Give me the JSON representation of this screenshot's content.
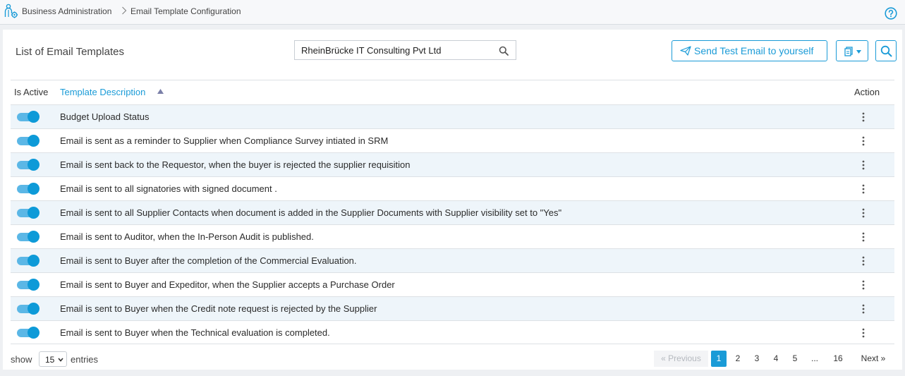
{
  "breadcrumb": {
    "items": [
      "Business Administration",
      "Email Template Configuration"
    ]
  },
  "page": {
    "title": "List of Email Templates"
  },
  "company_filter": {
    "value": "RheinBrücke IT Consulting Pvt Ltd"
  },
  "toolbar": {
    "send_test_label": "Send Test Email to yourself"
  },
  "table": {
    "columns": {
      "is_active": "Is Active",
      "description": "Template Description",
      "action": "Action"
    },
    "sort": {
      "column": "Template Description",
      "direction": "ascending"
    },
    "rows": [
      {
        "active": true,
        "description": "Budget Upload Status"
      },
      {
        "active": true,
        "description": "Email is sent as a reminder to Supplier when Compliance Survey intiated in SRM"
      },
      {
        "active": true,
        "description": "Email is sent back to the Requestor, when the buyer is rejected the supplier requisition"
      },
      {
        "active": true,
        "description": "Email is sent to all signatories with signed document ."
      },
      {
        "active": true,
        "description": "Email is sent to all Supplier Contacts when document is added in the Supplier Documents with Supplier visibility set to \"Yes\""
      },
      {
        "active": true,
        "description": "Email is sent to Auditor, when the In-Person Audit is published."
      },
      {
        "active": true,
        "description": "Email is sent to Buyer after the completion of the Commercial Evaluation."
      },
      {
        "active": true,
        "description": "Email is sent to Buyer and Expeditor, when the Supplier accepts a Purchase Order"
      },
      {
        "active": true,
        "description": "Email is sent to Buyer when the Credit note request is rejected by the Supplier"
      },
      {
        "active": true,
        "description": "Email is sent to Buyer when the Technical evaluation is completed."
      }
    ]
  },
  "footer": {
    "show_label": "show",
    "page_size": "15",
    "entries_label": "entries"
  },
  "pagination": {
    "previous_label": "« Previous",
    "pages": [
      "1",
      "2",
      "3",
      "4",
      "5",
      "...",
      "16"
    ],
    "current": "1",
    "next_label": "Next »"
  },
  "colors": {
    "accent": "#1a9bd7",
    "row_alt": "#eef5fa",
    "toggle_on": "#0d9ad8"
  }
}
